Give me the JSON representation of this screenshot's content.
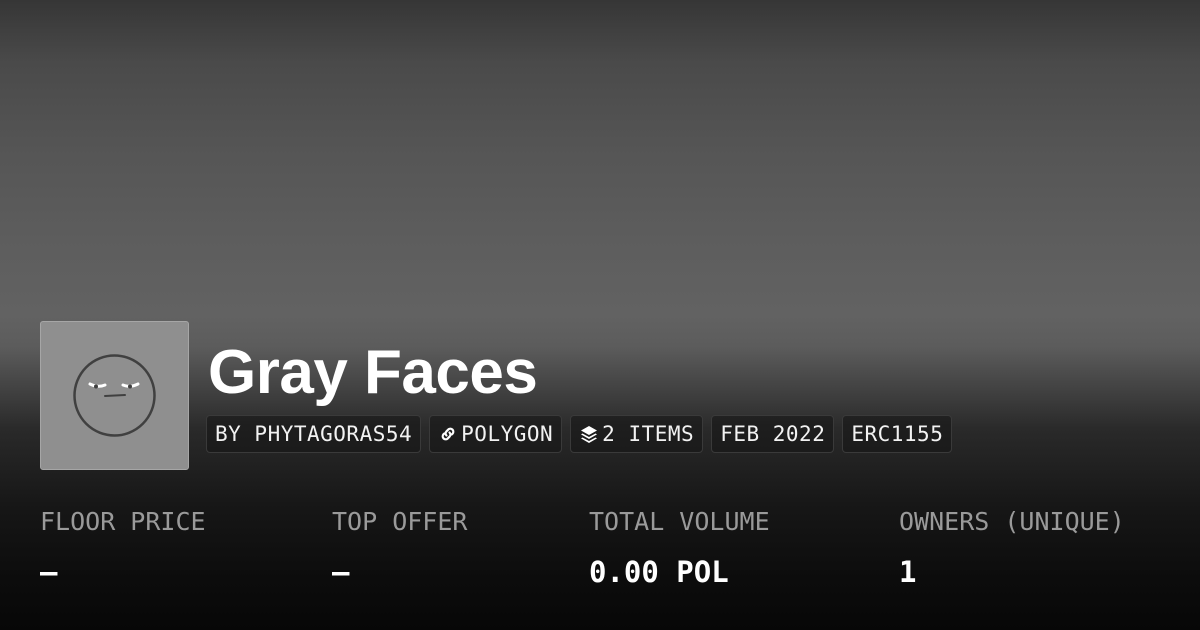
{
  "collection": {
    "name": "Gray Faces",
    "avatar_icon": "gray-face-icon"
  },
  "tags": [
    {
      "label": "BY PHYTAGORAS54",
      "icon": null
    },
    {
      "label": "POLYGON",
      "icon": "chain-link-icon"
    },
    {
      "label": "2 ITEMS",
      "icon": "layers-icon"
    },
    {
      "label": "FEB 2022",
      "icon": null
    },
    {
      "label": "ERC1155",
      "icon": null
    }
  ],
  "stats": [
    {
      "label": "FLOOR PRICE",
      "value": "–"
    },
    {
      "label": "TOP OFFER",
      "value": "–"
    },
    {
      "label": "TOTAL VOLUME",
      "value": "0.00 POL"
    },
    {
      "label": "OWNERS (UNIQUE)",
      "value": "1"
    }
  ],
  "colors": {
    "avatar_bg": "#8f8f8f",
    "label_gray": "#9a9a9a",
    "text": "#ffffff"
  }
}
